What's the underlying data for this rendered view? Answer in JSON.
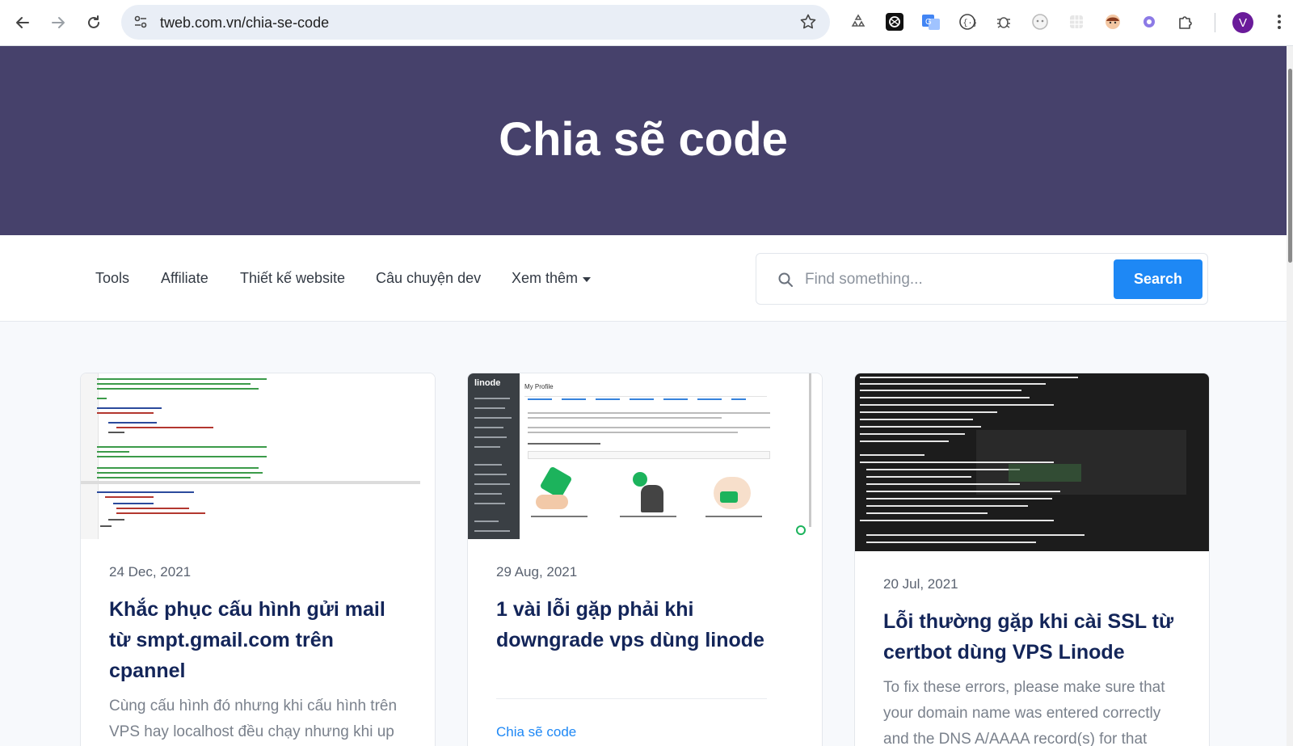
{
  "browser": {
    "url": "tweb.com.vn/chia-se-code",
    "profile_initial": "V"
  },
  "hero": {
    "title": "Chia sẽ code",
    "background": "#46416b"
  },
  "menu": {
    "items": [
      "Tools",
      "Affiliate",
      "Thiết kế website",
      "Câu chuyện dev"
    ],
    "more_label": "Xem thêm"
  },
  "search": {
    "placeholder": "Find something...",
    "button_label": "Search",
    "accent": "#1e88f5"
  },
  "posts": [
    {
      "date": "24 Dec, 2021",
      "title": "Khắc phục cấu hình gửi mail từ smpt.gmail.com trên cpannel",
      "excerpt": "Cùng cấu hình đó nhưng khi cấu hình trên VPS hay localhost đều chạy nhưng khi up",
      "thumbnail": "code-editor-screenshot"
    },
    {
      "date": "29 Aug, 2021",
      "title": "1 vài lỗi gặp phải khi downgrade vps dùng linode",
      "category": "Chia sẽ code",
      "thumbnail": "linode-referrals-screenshot",
      "thumb_text": {
        "logo": "linode",
        "heading": "My Profile"
      }
    },
    {
      "date": "20 Jul, 2021",
      "title": "Lỗi thường gặp khi cài SSL từ certbot dùng VPS Linode",
      "excerpt": "To fix these errors, please make sure that your domain name was entered correctly and the DNS A/AAAA record(s) for that",
      "thumbnail": "terminal-certbot-screenshot"
    }
  ]
}
